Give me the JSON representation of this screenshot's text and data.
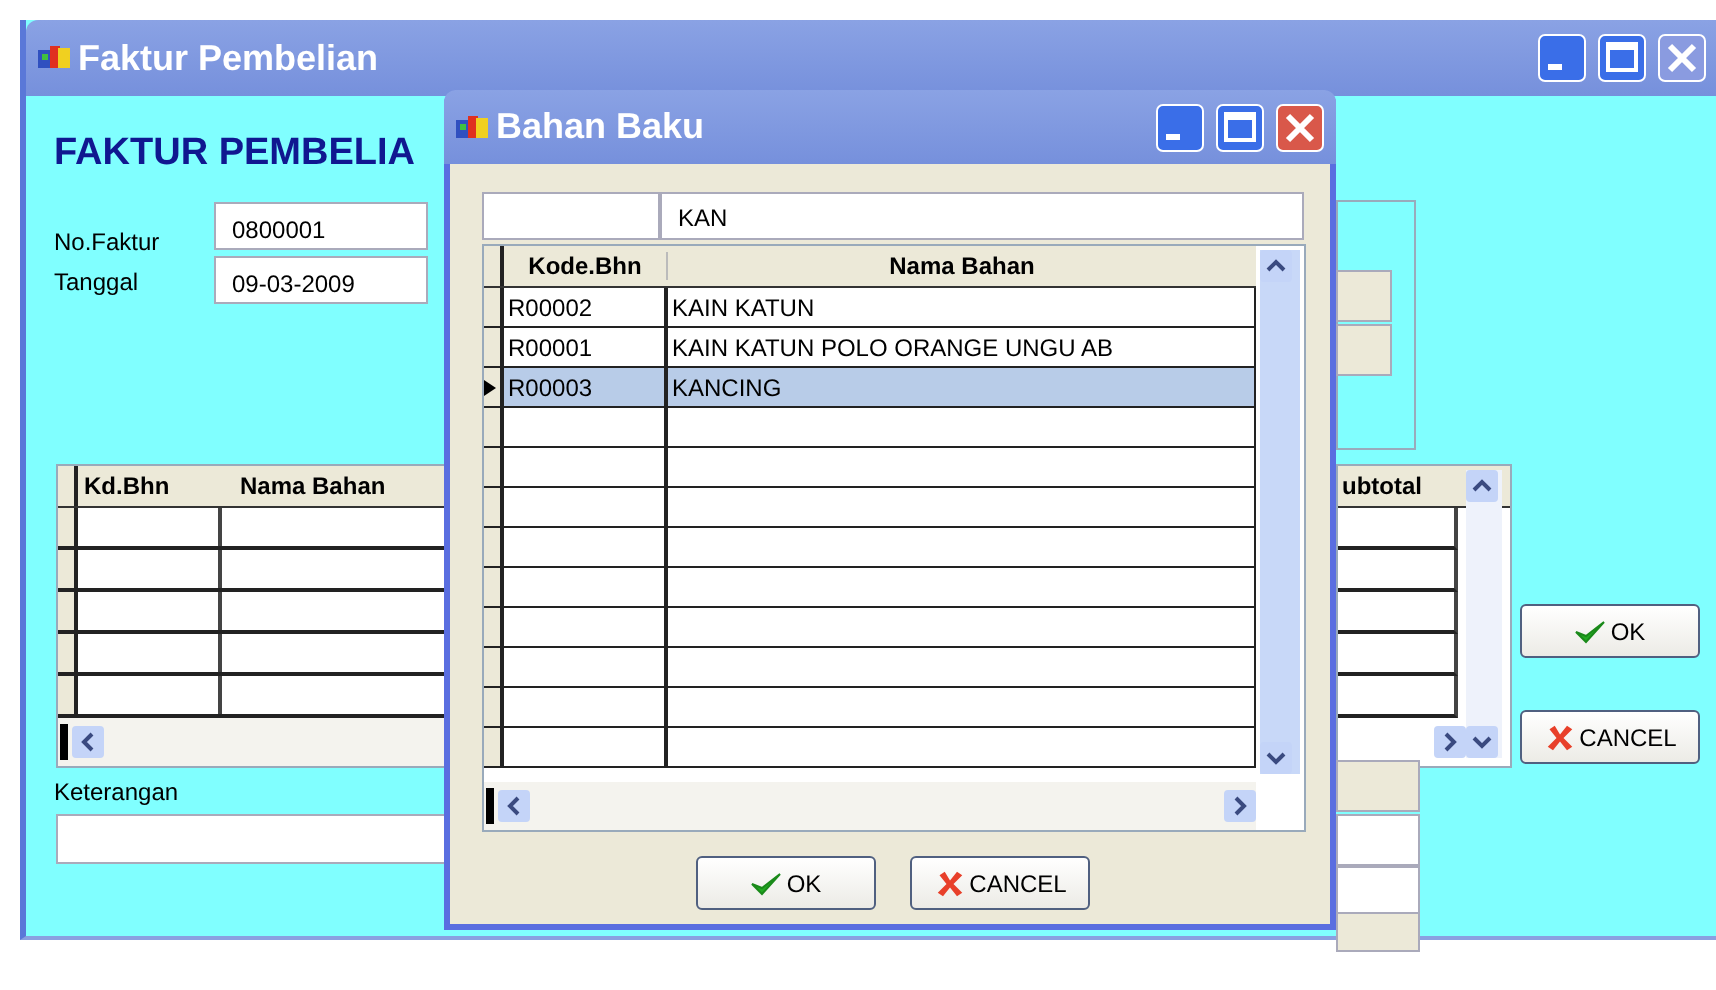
{
  "main_window": {
    "title": "Faktur Pembelian",
    "heading": "FAKTUR PEMBELIA",
    "fields": [
      {
        "label": "No.Faktur",
        "value": "0800001"
      },
      {
        "label": "Tanggal",
        "value": "09-03-2009"
      }
    ],
    "table": {
      "columns": [
        "Kd.Bhn",
        "Nama Bahan"
      ],
      "right_column": "ubtotal"
    },
    "notes": {
      "label": "Keterangan"
    },
    "buttons": [
      {
        "kind": "ok",
        "label": "OK"
      },
      {
        "kind": "cancel",
        "label": "CANCEL"
      }
    ]
  },
  "dialog": {
    "title": "Bahan Baku",
    "search": {
      "value": "KAN"
    },
    "columns": [
      "Kode.Bhn",
      "Nama Bahan"
    ],
    "rows": [
      {
        "code": "R00002",
        "name": "KAIN KATUN",
        "selected": false
      },
      {
        "code": "R00001",
        "name": "KAIN KATUN POLO ORANGE UNGU AB",
        "selected": false
      },
      {
        "code": "R00003",
        "name": "KANCING",
        "selected": true
      }
    ],
    "buttons": [
      {
        "kind": "ok",
        "label": "OK"
      },
      {
        "kind": "cancel",
        "label": "CANCEL"
      }
    ]
  }
}
